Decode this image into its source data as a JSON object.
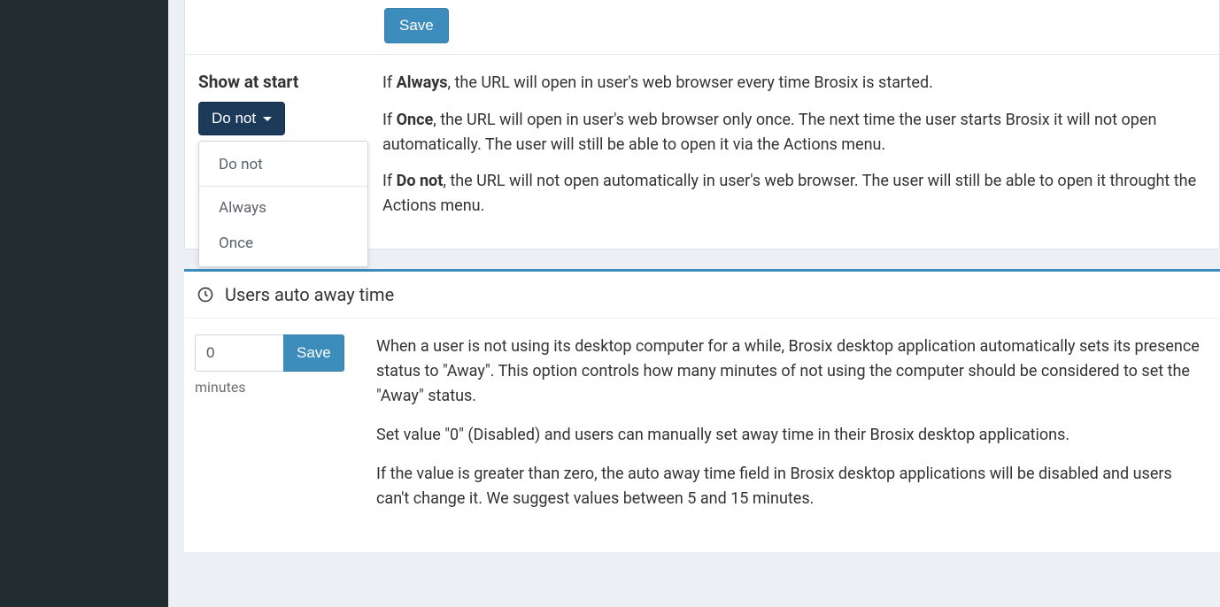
{
  "topSave": {
    "label": "Save"
  },
  "showAtStart": {
    "label": "Show at start",
    "selected": "Do not",
    "options": [
      "Do not",
      "Always",
      "Once"
    ],
    "desc": {
      "always_bold": "Always",
      "always_rest": ", the URL will open in user's web browser every time Brosix is started.",
      "once_bold": "Once",
      "once_rest": ", the URL will open in user's web browser only once. The next time the user starts Brosix it will not open automatically. The user will still be able to open it via the Actions menu.",
      "donot_bold": "Do not",
      "donot_rest": ", the URL will not open automatically in user's web browser. The user will still be able to open it throught the Actions menu.",
      "if_prefix": "If "
    }
  },
  "autoAway": {
    "title": "Users auto away time",
    "value": "0",
    "saveLabel": "Save",
    "unit": "minutes",
    "p1": "When a user is not using its desktop computer for a while, Brosix desktop application automatically sets its presence status to \"Away\". This option controls how many minutes of not using the computer should be considered to set the \"Away\" status.",
    "p2": "Set value \"0\" (Disabled) and users can manually set away time in their Brosix desktop applications.",
    "p3": "If the value is greater than zero, the auto away time field in Brosix desktop applications will be disabled and users can't change it. We suggest values between 5 and 15 minutes."
  }
}
